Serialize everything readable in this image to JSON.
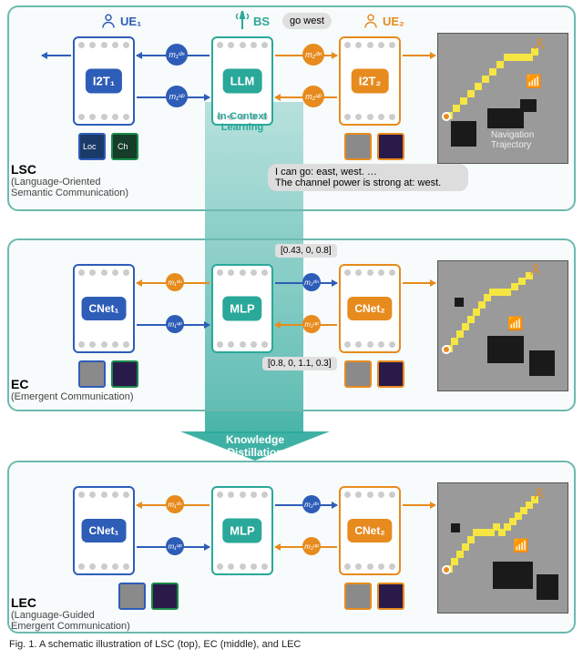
{
  "panel1": {
    "title": "LSC",
    "subtitle": "(Language-Oriented\nSemantic Communication)",
    "ue1": "UE₁",
    "ue2": "UE₂",
    "bs": "BS",
    "left_net": "I2T₁",
    "center_net": "LLM",
    "right_net": "I2T₂",
    "ctx": "In-Context\nLearning",
    "msg_left_dn": "m₁ᵈⁿ",
    "msg_left_up": "m₁ᵘᵖ",
    "msg_right_dn": "m₂ᵈⁿ",
    "msg_right_up": "m₂ᵘᵖ",
    "speech_top": "go west",
    "speech_bot": "I can go: east, west. …\nThe channel power is strong at: west.",
    "loc": "Loc",
    "ch": "Ch",
    "nav": "Navigation\nTrajectory"
  },
  "panel2": {
    "title": "EC",
    "subtitle": "(Emergent Communication)",
    "left_net": "CNet₁",
    "center_net": "MLP",
    "right_net": "CNet₂",
    "msg_left_dn": "m₁ᵈⁿ",
    "msg_left_up": "m₁ᵘᵖ",
    "msg_right_dn": "m₂ᵈⁿ",
    "msg_right_up": "m₂ᵘᵖ",
    "vec_top": "[0.43, 0, 0.8]",
    "vec_bot": "[0.8, 0, 1.1, 0.3]"
  },
  "panel3": {
    "title": "LEC",
    "subtitle": "(Language-Guided\nEmergent Communication)",
    "left_net": "CNet₁",
    "center_net": "MLP",
    "right_net": "CNet₂",
    "msg_left_dn": "m₁ᵈⁿ",
    "msg_left_up": "m₁ᵘᵖ",
    "msg_right_dn": "m₂ᵈⁿ",
    "msg_right_up": "m₂ᵘᵖ"
  },
  "kd": "Knowledge\nDistillation",
  "caption": "Fig. 1. A schematic illustration of LSC (top), EC (middle), and LEC"
}
